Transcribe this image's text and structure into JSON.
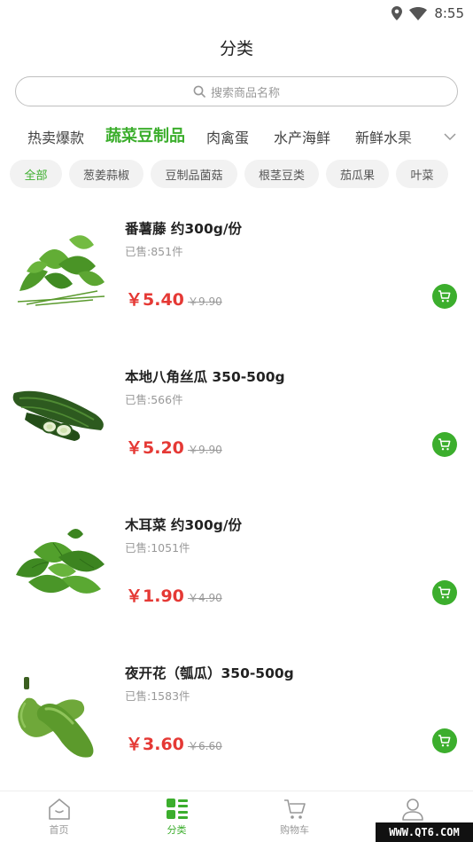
{
  "status_bar": {
    "time": "8:55",
    "icons": [
      "location-icon",
      "wifi-icon"
    ]
  },
  "page": {
    "title": "分类"
  },
  "search": {
    "placeholder": "搜索商品名称"
  },
  "categories": [
    {
      "label": "热卖爆款",
      "active": false
    },
    {
      "label": "蔬菜豆制品",
      "active": true
    },
    {
      "label": "肉禽蛋",
      "active": false
    },
    {
      "label": "水产海鲜",
      "active": false
    },
    {
      "label": "新鲜水果",
      "active": false
    }
  ],
  "subcategories": [
    {
      "label": "全部",
      "active": true
    },
    {
      "label": "葱姜蒜椒",
      "active": false
    },
    {
      "label": "豆制品菌菇",
      "active": false
    },
    {
      "label": "根茎豆类",
      "active": false
    },
    {
      "label": "茄瓜果",
      "active": false
    },
    {
      "label": "叶菜",
      "active": false
    }
  ],
  "products": [
    {
      "name": "番薯藤 约300g/份",
      "sold": "已售:851件",
      "price": "￥5.40",
      "original_price": "￥9.90",
      "image": "sweet-potato-vine-image"
    },
    {
      "name": "本地八角丝瓜 350-500g",
      "sold": "已售:566件",
      "price": "￥5.20",
      "original_price": "￥9.90",
      "image": "luffa-image"
    },
    {
      "name": "木耳菜 约300g/份",
      "sold": "已售:1051件",
      "price": "￥1.90",
      "original_price": "￥4.90",
      "image": "malabar-spinach-image"
    },
    {
      "name": "夜开花（瓠瓜）350-500g",
      "sold": "已售:1583件",
      "price": "￥3.60",
      "original_price": "￥6.60",
      "image": "bottle-gourd-image"
    }
  ],
  "bottom_nav": [
    {
      "label": "首页",
      "icon": "home-icon",
      "active": false
    },
    {
      "label": "分类",
      "icon": "category-icon",
      "active": true
    },
    {
      "label": "购物车",
      "icon": "cart-icon",
      "active": false
    },
    {
      "label": "我的",
      "icon": "user-icon",
      "active": false
    }
  ],
  "watermark": "WWW.QT6.COM",
  "colors": {
    "accent": "#3cae2d",
    "price": "#e53935"
  }
}
